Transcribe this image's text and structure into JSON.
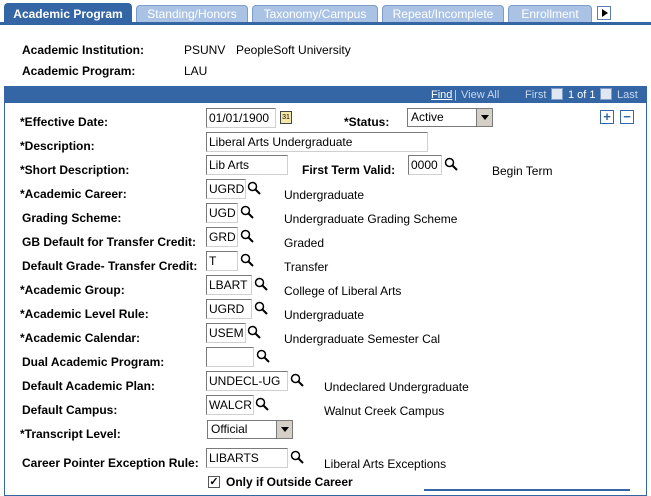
{
  "tabs": [
    {
      "label": "Academic Program",
      "active": true
    },
    {
      "label": "Standing/Honors",
      "active": false
    },
    {
      "label": "Taxonomy/Campus",
      "active": false
    },
    {
      "label": "Repeat/Incomplete",
      "active": false
    },
    {
      "label": "Enrollment",
      "active": false
    }
  ],
  "header": {
    "institution_label": "Academic Institution:",
    "institution_code": "PSUNV",
    "institution_name": "PeopleSoft University",
    "program_label": "Academic Program:",
    "program_code": "LAU"
  },
  "nav": {
    "find": "Find",
    "separator": "|",
    "view_all": "View All",
    "first": "First",
    "count": "1 of 1",
    "last": "Last"
  },
  "form": {
    "effective_date": {
      "label": "*Effective Date:",
      "value": "01/01/1900"
    },
    "status": {
      "label": "*Status:",
      "value": "Active"
    },
    "description": {
      "label": "*Description:",
      "value": "Liberal Arts Undergraduate"
    },
    "short_description": {
      "label": "*Short Description:",
      "value": "Lib Arts"
    },
    "first_term_valid": {
      "label": "First Term Valid:",
      "value": "0000",
      "desc": "Begin Term"
    },
    "academic_career": {
      "label": "*Academic Career:",
      "value": "UGRD",
      "desc": "Undergraduate"
    },
    "grading_scheme": {
      "label": "Grading Scheme:",
      "value": "UGD",
      "desc": "Undergraduate Grading Scheme"
    },
    "gb_default": {
      "label": "GB Default for Transfer Credit:",
      "value": "GRD",
      "desc": "Graded"
    },
    "default_grade_transfer": {
      "label": "Default Grade- Transfer Credit:",
      "value": "T",
      "desc": "Transfer"
    },
    "academic_group": {
      "label": "*Academic Group:",
      "value": "LBART",
      "desc": "College of Liberal Arts"
    },
    "academic_level_rule": {
      "label": "*Academic Level Rule:",
      "value": "UGRD",
      "desc": "Undergraduate"
    },
    "academic_calendar": {
      "label": "*Academic Calendar:",
      "value": "USEM",
      "desc": "Undergraduate Semester Cal"
    },
    "dual_academic_program": {
      "label": "Dual Academic Program:",
      "value": ""
    },
    "default_academic_plan": {
      "label": "Default Academic Plan:",
      "value": "UNDECL-UG",
      "desc": "Undeclared Undergraduate"
    },
    "default_campus": {
      "label": "Default Campus:",
      "value": "WALCR",
      "desc": "Walnut Creek Campus"
    },
    "transcript_level": {
      "label": "*Transcript Level:",
      "value": "Official"
    },
    "career_pointer_exception": {
      "label": "Career Pointer Exception Rule:",
      "value": "LIBARTS",
      "desc": "Liberal Arts Exceptions"
    },
    "only_outside_career": {
      "label": "Only if Outside Career",
      "checked": true
    }
  },
  "colors": {
    "tab_active": "#3465a4",
    "tab_inactive": "#aac3e4"
  }
}
